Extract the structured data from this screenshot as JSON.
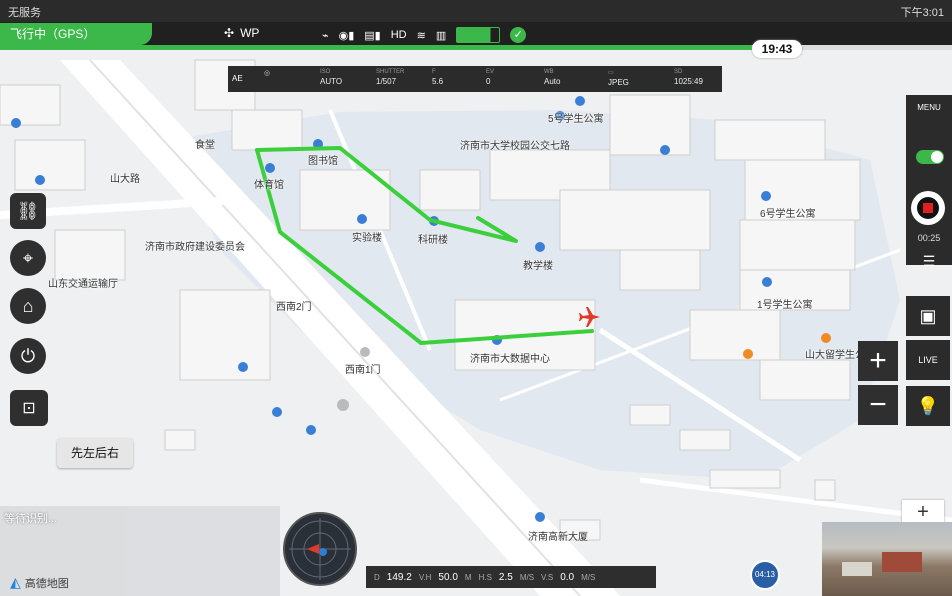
{
  "system_bar": {
    "carrier": "无服务",
    "right_text": "下午3:01"
  },
  "top_bar": {
    "flight_status": "飞行中（GPS）",
    "wp_label": "WP",
    "hd_label": "HD",
    "ok_symbol": "✓"
  },
  "progress": {
    "fraction": 0.79
  },
  "time_pill": "19:43",
  "camera_bar": {
    "ae_label": "AE",
    "items": [
      {
        "label": "ISO",
        "value": "AUTO"
      },
      {
        "label": "SHUTTER",
        "value": "1/507"
      },
      {
        "label": "F",
        "value": "5.6"
      },
      {
        "label": "EV",
        "value": "0"
      },
      {
        "label": "WB",
        "value": "Auto"
      },
      {
        "label": "",
        "value": "JPEG"
      },
      {
        "label": "SD",
        "value": "1025:49"
      }
    ]
  },
  "left_controls": {
    "order_button": "先左后右"
  },
  "right_panel": {
    "menu": "MENU",
    "record_time": "00:25",
    "live": "LIVE"
  },
  "map_labels": [
    "食堂",
    "体育馆",
    "图书馆",
    "实验楼",
    "科研楼",
    "教学楼",
    "5号学生公寓",
    "6号学生公寓",
    "1号学生公寓",
    "山大留学生公寓",
    "济南市大学校园公交七路",
    "济南市政府建设委员会",
    "山东交通运输厅",
    "西南1门",
    "西南2门",
    "山大路",
    "济南市大数据中心",
    "济南高新大厦"
  ],
  "bottom_left": {
    "status": "等待识别...",
    "brand": "高德地图"
  },
  "telemetry": {
    "d_label": "D",
    "d_value": "149.2",
    "vh_label": "V.H",
    "vh_value": "50.0",
    "m_label": "M",
    "hs_label": "H.S",
    "hs_value": "2.5",
    "hs_unit": "M/S",
    "vs_label": "V.S",
    "vs_value": "0.0",
    "vs_unit": "M/S"
  },
  "speed_dot": "04:13",
  "colors": {
    "accent_green": "#3cb84a",
    "route": "#3ccf3c",
    "record_red": "#e02020",
    "aircraft": "#e23a2a"
  }
}
